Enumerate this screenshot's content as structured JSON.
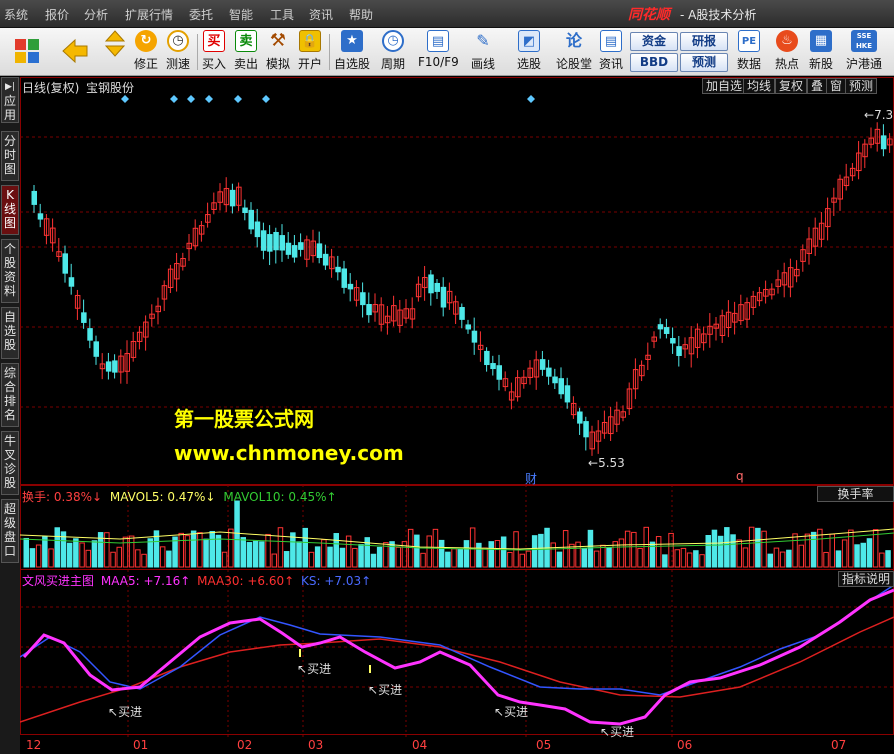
{
  "menubar": {
    "items": [
      "系统",
      "报价",
      "分析",
      "扩展行情",
      "委托",
      "智能",
      "工具",
      "资讯",
      "帮助"
    ],
    "logo": "同花顺",
    "subtitle": "- A股技术分析"
  },
  "toolbar": {
    "buttons": [
      "修正",
      "测速",
      "买入",
      "卖出",
      "模拟",
      "开户",
      "自选股",
      "周期",
      "F10/F9",
      "画线",
      "选股",
      "论股堂",
      "资讯",
      "数据",
      "热点",
      "新股",
      "沪港通"
    ],
    "small_buttons": [
      "资金",
      "研报",
      "BBD",
      "预测"
    ],
    "icon_labels": {
      "buy": "买",
      "sell": "卖"
    },
    "hk_badge": "SSE HKE"
  },
  "side_tabs": [
    "应用",
    "分时图",
    "K线图",
    "个股资料",
    "自选股",
    "综合排名",
    "牛叉诊股",
    "超级盘口"
  ],
  "chart": {
    "title": "日线(复权)",
    "stock": "宝钢股份",
    "top_buttons": [
      "加自选",
      "均线",
      "复权",
      "叠",
      "窗",
      "预测"
    ],
    "high_label": "7.3",
    "low_label": "5.53",
    "marker_cai": "财",
    "marker_q": "q"
  },
  "volume_panel": {
    "label_main": "换手",
    "value_main": "0.38%↓",
    "label_ma5": "MAVOL5",
    "value_ma5": "0.47%↓",
    "label_ma10": "MAVOL10",
    "value_ma10": "0.45%↑",
    "button": "换手率"
  },
  "indicator_panel": {
    "name": "文风买进主图",
    "label_maa5": "MAA5",
    "value_maa5": "+7.16↑",
    "label_maa30": "MAA30",
    "value_maa30": "+6.60↑",
    "label_ks": "KS",
    "value_ks": "+7.03↑",
    "button": "指标说明",
    "signal_label": "买进"
  },
  "x_axis": {
    "ticks": [
      "12",
      "01",
      "02",
      "03",
      "04",
      "05",
      "06",
      "07"
    ]
  },
  "watermark": {
    "line1": "第一股票公式网",
    "line2": "www.chnmoney.com"
  },
  "colors": {
    "up": "#ff3333",
    "down": "#4ee8e8",
    "magenta": "#ff33ff",
    "blue": "#3355ff",
    "red": "#dd2020",
    "yellow": "#ffff00",
    "grid": "#7a0000"
  }
}
